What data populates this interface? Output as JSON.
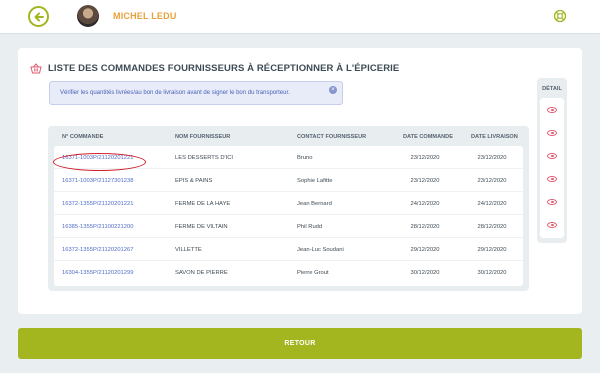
{
  "header": {
    "user_name": "MICHEL LEDU",
    "back_icon": "back-arrow-icon",
    "help_icon": "lifebuoy-icon",
    "accent_color": "#a3b61f",
    "name_color": "#e8a13a"
  },
  "main": {
    "title": "LISTE DES COMMANDES FOURNISSEURS À RÉCEPTIONNER À L'ÉPICERIE",
    "alert_text": "Vérifier les quantités livrées/au bon de livraison avant de signer le bon du transporteur.",
    "alert_close": "×",
    "columns": {
      "order_number": "N° COMMANDE",
      "supplier_name": "NOM FOURNISSEUR",
      "supplier_contact": "CONTACT FOURNISSEUR",
      "order_date": "DATE COMMANDE",
      "delivery_date": "DATE LIVRAISON",
      "detail": "DÉTAIL"
    },
    "orders": [
      {
        "number": "16371-1003P/21120201221",
        "supplier": "LES DESSERTS D'ICI",
        "contact": "Bruno",
        "order_date": "23/12/2020",
        "delivery_date": "23/12/2020"
      },
      {
        "number": "16371-1003P/21127301238",
        "supplier": "EPIS & PAINS",
        "contact": "Sophie Lafitte",
        "order_date": "23/12/2020",
        "delivery_date": "23/12/2020"
      },
      {
        "number": "16372-1355P/21120201221",
        "supplier": "FERME DE LA HAYE",
        "contact": "Jean Bernard",
        "order_date": "24/12/2020",
        "delivery_date": "24/12/2020"
      },
      {
        "number": "16385-1355P/21100221200",
        "supplier": "FERME DE VILTAIN",
        "contact": "Phil Rudd",
        "order_date": "28/12/2020",
        "delivery_date": "28/12/2020"
      },
      {
        "number": "16372-1355P/21120201267",
        "supplier": "VILLETTE",
        "contact": "Jean-Luc Soudani",
        "order_date": "29/12/2020",
        "delivery_date": "29/12/2020"
      },
      {
        "number": "16304-1355P/21120201299",
        "supplier": "SAVON DE PIERRE",
        "contact": "Pierre Grout",
        "order_date": "30/12/2020",
        "delivery_date": "30/12/2020"
      }
    ],
    "detail_icon": "eye-icon"
  },
  "footer": {
    "retour_label": "RETOUR"
  }
}
